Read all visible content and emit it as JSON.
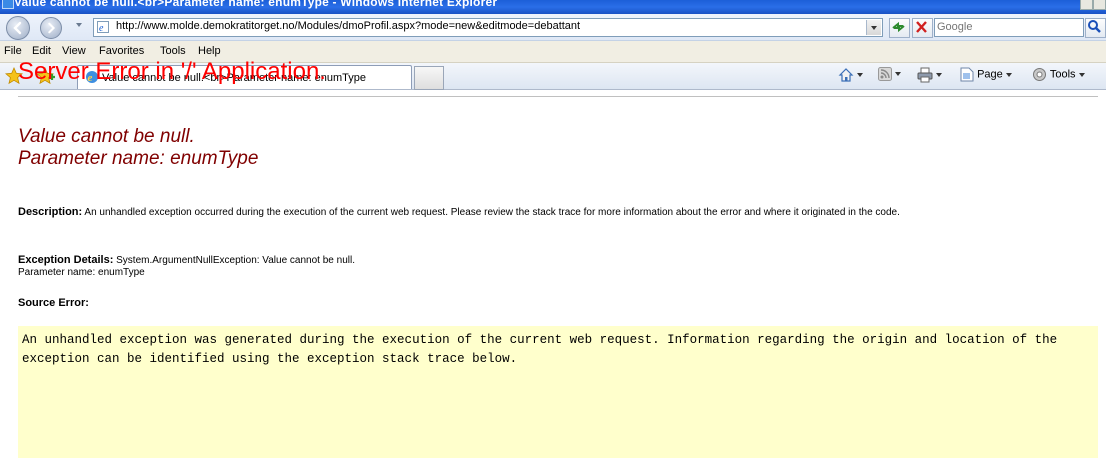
{
  "window": {
    "title": "Value cannot be null.<br>Parameter name: enumType - Windows Internet Explorer"
  },
  "addressbar": {
    "url": "http://www.molde.demokratitorget.no/Modules/dmoProfil.aspx?mode=new&editmode=debattant"
  },
  "search": {
    "placeholder": "Google"
  },
  "menubar": {
    "file": "File",
    "edit": "Edit",
    "view": "View",
    "favorites": "Favorites",
    "tools": "Tools",
    "help": "Help"
  },
  "tabbar": {
    "tab_title": "Value cannot be null.<br>Parameter name: enumType"
  },
  "commandbar": {
    "page": "Page",
    "tools": "Tools"
  },
  "page": {
    "heading": "Server Error in '/' Application.",
    "error_line1": "Value cannot be null.",
    "error_line2": "Parameter name: enumType",
    "description_label": "Description:",
    "description_text": " An unhandled exception occurred during the execution of the current web request. Please review the stack trace for more information about the error and where it originated in the code.",
    "exception_label": "Exception Details:",
    "exception_text": " System.ArgumentNullException: Value cannot be null.",
    "exception_param": "Parameter name: enumType",
    "source_error_label": "Source Error:",
    "source_error_text": "An unhandled exception was generated during the execution of the current web request. Information regarding the origin and location of the exception can be identified using the exception stack trace below."
  },
  "icons": {
    "back": "back-arrow-icon",
    "forward": "forward-arrow-icon",
    "refresh": "refresh-icon",
    "stop": "stop-icon",
    "search": "search-magnifier-icon",
    "favorites": "favorites-star-icon",
    "add_favorites": "add-favorites-icon",
    "home": "home-icon",
    "feeds": "feeds-icon",
    "print": "print-icon",
    "page": "page-icon",
    "tools": "tools-gear-icon"
  }
}
